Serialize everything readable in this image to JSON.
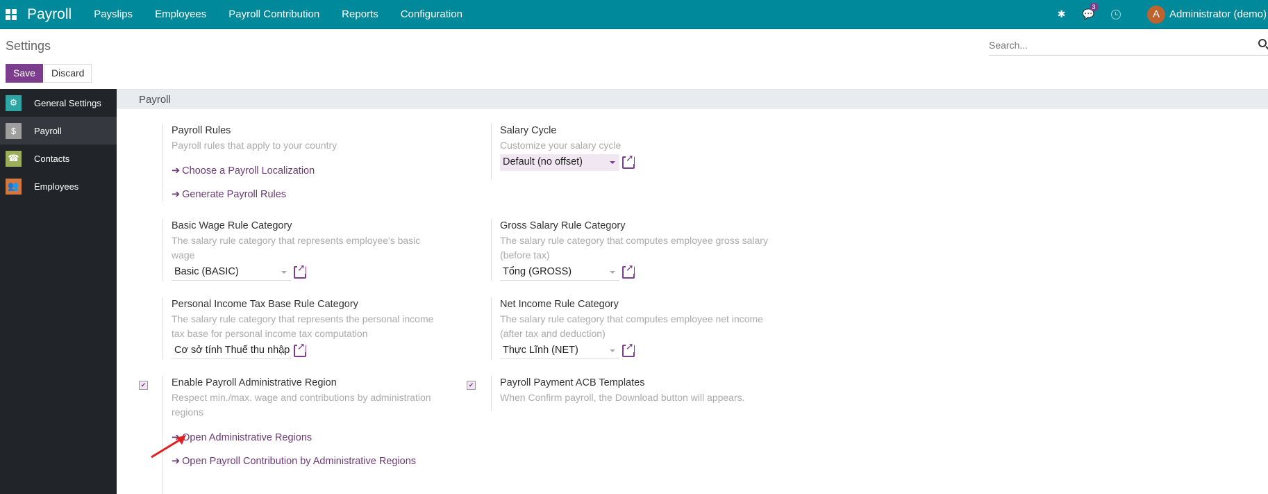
{
  "navbar": {
    "brand": "Payroll",
    "menu": [
      "Payslips",
      "Employees",
      "Payroll Contribution",
      "Reports",
      "Configuration"
    ],
    "messages_badge": "3",
    "user_initial": "A",
    "user_name": "Administrator (demo)",
    "colors": {
      "bg": "#00899a",
      "accent": "#7c3e8c"
    }
  },
  "control": {
    "title": "Settings",
    "save_label": "Save",
    "discard_label": "Discard",
    "search_placeholder": "Search..."
  },
  "sidebar": {
    "items": [
      {
        "label": "General Settings",
        "icon": "gear-icon",
        "color": "#2ea6a6"
      },
      {
        "label": "Payroll",
        "icon": "payroll-icon",
        "color": "#9e9e9e",
        "active": true
      },
      {
        "label": "Contacts",
        "icon": "contacts-icon",
        "color": "#9cae5a"
      },
      {
        "label": "Employees",
        "icon": "employees-icon",
        "color": "#d4773f"
      }
    ]
  },
  "section": {
    "title": "Payroll",
    "payroll_rules": {
      "title": "Payroll Rules",
      "desc": "Payroll rules that apply to your country",
      "links": [
        "Choose a Payroll Localization",
        "Generate Payroll Rules"
      ]
    },
    "salary_cycle": {
      "title": "Salary Cycle",
      "desc": "Customize your salary cycle",
      "value": "Default (no offset)"
    },
    "basic_wage": {
      "title": "Basic Wage Rule Category",
      "desc": "The salary rule category that represents employee's basic wage",
      "value": "Basic (BASIC)"
    },
    "gross_salary": {
      "title": "Gross Salary Rule Category",
      "desc": "The salary rule category that computes employee gross salary (before tax)",
      "value": "Tổng (GROSS)"
    },
    "pit_base": {
      "title": "Personal Income Tax Base Rule Category",
      "desc": "The salary rule category that represents the personal income tax base for personal income tax computation",
      "value": "Cơ sở tính Thuế thu nhập"
    },
    "net_income": {
      "title": "Net Income Rule Category",
      "desc": "The salary rule category that computes employee net income (after tax and deduction)",
      "value": "Thực Lĩnh (NET)"
    },
    "admin_region": {
      "title": "Enable Payroll Administrative Region",
      "desc": "Respect min./max. wage and contributions by administration regions",
      "checked": true,
      "links": [
        "Open Administrative Regions",
        "Open Payroll Contribution by Administrative Regions"
      ]
    },
    "acb_templates": {
      "title": "Payroll Payment ACB Templates",
      "desc": "When Confirm payroll, the Download button will appears.",
      "checked": true
    }
  }
}
